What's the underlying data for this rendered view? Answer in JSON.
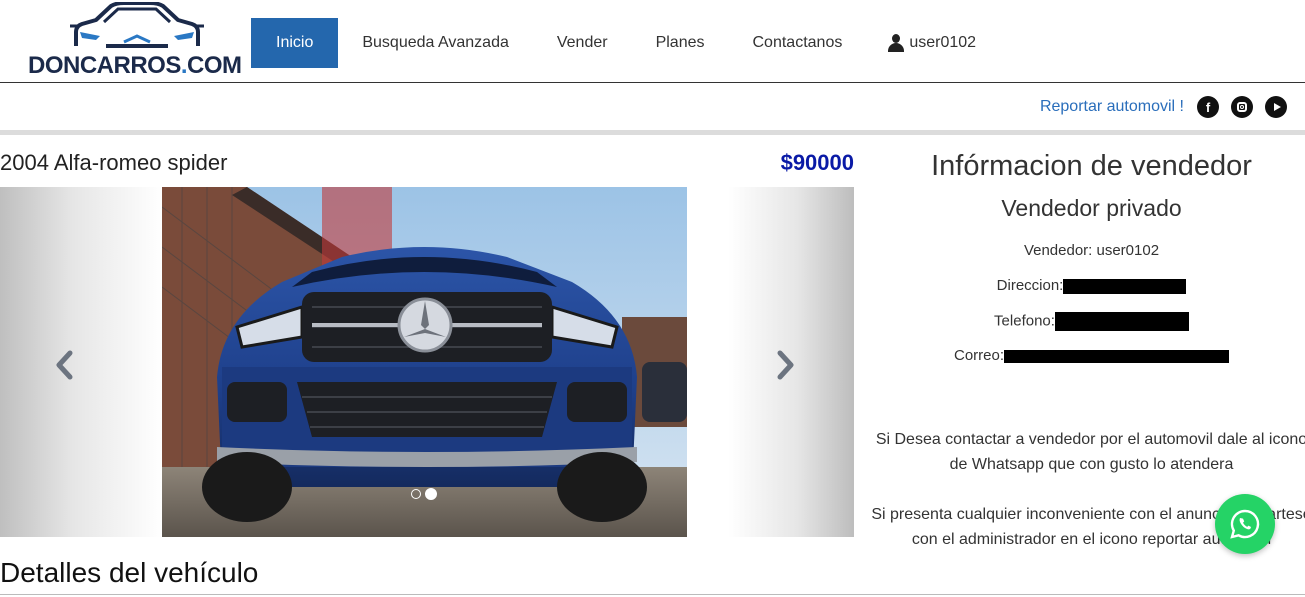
{
  "brand": {
    "logo_main": "DONCARROS",
    "logo_dot": ".",
    "logo_tld": "COM"
  },
  "nav": {
    "items": [
      {
        "label": "Inicio",
        "active": true
      },
      {
        "label": "Busqueda Avanzada"
      },
      {
        "label": "Vender"
      },
      {
        "label": "Planes"
      },
      {
        "label": "Contactanos"
      }
    ],
    "user": {
      "icon": "user-icon",
      "label": "user0102"
    }
  },
  "report": {
    "label": "Reportar automovil !",
    "social": [
      "facebook-icon",
      "instagram-icon",
      "youtube-icon"
    ]
  },
  "listing": {
    "title": "2004 Alfa-romeo spider",
    "price": "$90000",
    "carousel": {
      "slide_count": 2,
      "active_index": 1
    },
    "details_heading": "Detalles del vehículo"
  },
  "seller": {
    "title": "Infórmacion de vendedor",
    "subtitle": "Vendedor privado",
    "vendor_label": "Vendedor: user0102",
    "address_label": "Direccion:",
    "phone_label": "Telefono:",
    "email_label": "Correo:",
    "contact_text": "Si Desea contactar a vendedor por el automovil dale al icono de Whatsapp que con gusto lo atendera",
    "issue_text": "Si presenta cualquier inconveniente con el anuncio contartese con el administrador en el icono reportar automovil"
  },
  "colors": {
    "accent": "#2467ad",
    "price": "#0a1aa6",
    "whatsapp": "#25d366",
    "link": "#2a6ebb"
  }
}
